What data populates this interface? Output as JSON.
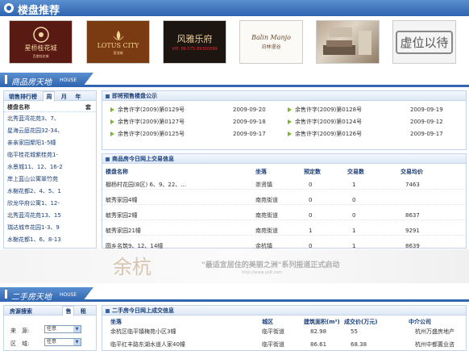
{
  "header": {
    "title": "楼盘推荐"
  },
  "logos": [
    {
      "main": "星桥桂花城",
      "sub": "百度桂花城"
    },
    {
      "main": "LOTUS CITY",
      "sub": "莲池城"
    },
    {
      "main": "风雅乐府",
      "sub": "VIP: 86-571-89300099"
    },
    {
      "main": "Balin Manjo",
      "sub": "泊林漫谷"
    },
    {
      "main": "",
      "sub": ""
    },
    {
      "main": "虚位以待",
      "sub": ""
    }
  ],
  "new_section": {
    "title": "商品房天地",
    "en": "HOUSE"
  },
  "rank": {
    "title": "销售排行榜",
    "tabs": [
      "周",
      "月",
      "年"
    ],
    "col_name": "楼盘名称",
    "col_units": "套",
    "items": [
      "北秀蓝湾花苑3、7、",
      "星海云庭花园32-34、",
      "亲亲家园聚阳1-5幢",
      "临平桂花城紫桂苑1-",
      "水景城11、12、16-2",
      "岸上蓝山公寓翠竹苑",
      "水榭花都2、4、5、1",
      "欣龙华府公寓1、12-",
      "北秀蓝湾花苑13、15",
      "瑞达城市花园1-3、9",
      "水榭花都1、6、8-13"
    ]
  },
  "presale": {
    "title": "即将预售楼盘公示",
    "rows": [
      {
        "a": "余售许字(2009)第0129号",
        "ad": "2009-09-20",
        "b": "余售许字(2009)第0128号",
        "bd": "2009-09-19"
      },
      {
        "a": "余售许字(2009)第0127号",
        "ad": "2009-09-18",
        "b": "余售许字(2009)第0124号",
        "bd": "2009-09-12"
      },
      {
        "a": "余售许字(2009)第0125号",
        "ad": "2009-09-17",
        "b": "余售许字(2009)第0126号",
        "bd": "2009-09-17"
      }
    ]
  },
  "trade": {
    "title": "商品房今日网上交易信息",
    "cols": [
      "楼盘名称",
      "坐落",
      "预定数",
      "交易数",
      "交易均价"
    ],
    "rows": [
      [
        "棚杨村花园(B区) 6、9、22、...",
        "崇贤镇",
        "0",
        "1",
        "7463"
      ],
      [
        "毓秀家园4幢",
        "南苑街道",
        "0",
        "0",
        ""
      ],
      [
        "毓秀家园2幢",
        "南苑街道",
        "0",
        "0",
        "8637"
      ],
      [
        "毓秀家园21幢",
        "南苑街道",
        "1",
        "1",
        "9291"
      ],
      [
        "圆乡名筑9、12、14幢",
        "余杭镇",
        "0",
        "1",
        "8639"
      ]
    ]
  },
  "banner": {
    "slogan": "\"最适宜居住的美丽之洲\"系列报道正式启动",
    "mark": "余杭",
    "url": "http://www.yk8.com"
  },
  "second_section": {
    "title": "二手房天地",
    "en": "HOUSE"
  },
  "search": {
    "title": "房源搜索",
    "tabs": [
      "售",
      "租"
    ],
    "fields": [
      {
        "label": "来　源:",
        "value": "任意"
      },
      {
        "label": "区　域:",
        "value": "任意"
      }
    ]
  },
  "second_trade": {
    "title": "二手房今日网上成交信息",
    "cols": [
      "坐落",
      "城区",
      "建筑面积(m²)",
      "成交价(万元)",
      "中介公司"
    ],
    "rows": [
      [
        "余杭区临平镇梅苑小区3幢",
        "临平街道",
        "82.98",
        "55",
        "杭州万盛房地产"
      ],
      [
        "临平红丰路东湖水道人家40幢",
        "临平街道",
        "86.61",
        "68.38",
        "杭州中都置业咨"
      ]
    ]
  },
  "colors": {
    "primary": "#2e64b0",
    "accent": "#7ab82a"
  }
}
